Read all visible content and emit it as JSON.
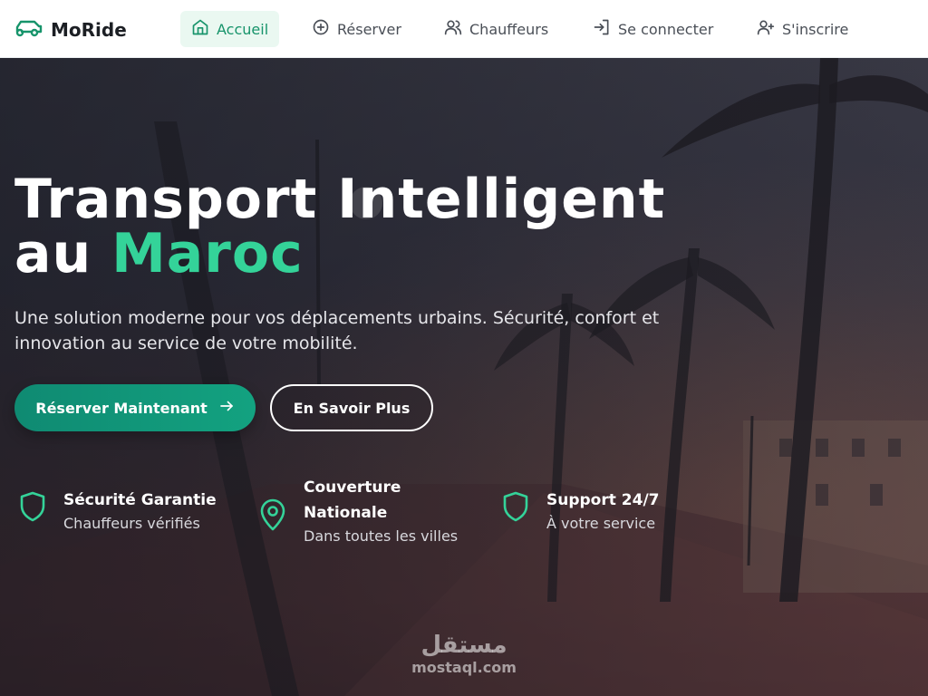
{
  "brand": {
    "name": "MoRide",
    "icon": "car-icon",
    "accent_color": "#17946b"
  },
  "nav": {
    "items": [
      {
        "label": "Accueil",
        "icon": "home-icon",
        "active": true
      },
      {
        "label": "Réserver",
        "icon": "plus-circle-icon",
        "active": false
      },
      {
        "label": "Chauffeurs",
        "icon": "users-icon",
        "active": false
      },
      {
        "label": "Se connecter",
        "icon": "login-icon",
        "active": false
      },
      {
        "label": "S'inscrire",
        "icon": "user-plus-icon",
        "active": false
      }
    ]
  },
  "hero": {
    "title_line1": "Transport Intelligent",
    "title_line2_prefix": "au ",
    "title_line2_accent": "Maroc",
    "subtitle": "Une solution moderne pour vos déplacements urbains. Sécurité, confort et innovation au service de votre mobilité.",
    "primary_button": {
      "label": "Réserver Maintenant",
      "icon": "arrow-right-icon"
    },
    "secondary_button": {
      "label": "En Savoir Plus"
    },
    "accent_color": "#34d399"
  },
  "features": [
    {
      "title": "Sécurité Garantie",
      "subtitle": "Chauffeurs vérifiés",
      "icon": "shield-icon"
    },
    {
      "title": "Couverture Nationale",
      "subtitle": "Dans toutes les villes",
      "icon": "map-pin-icon"
    },
    {
      "title": "Support 24/7",
      "subtitle": "À votre service",
      "icon": "shield-icon"
    }
  ],
  "watermark": {
    "arabic": "مستقل",
    "latin": "mostaql.com"
  }
}
